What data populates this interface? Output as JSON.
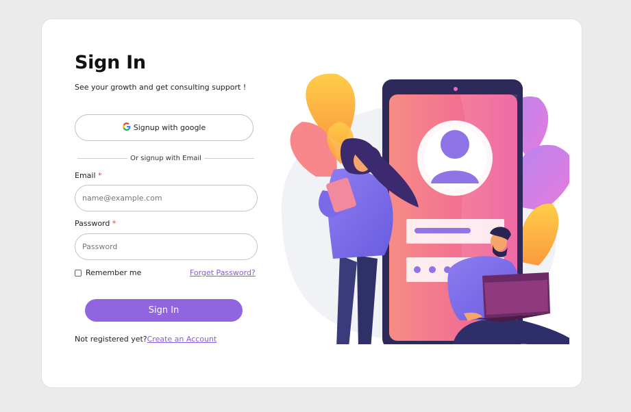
{
  "form": {
    "title": "Sign In",
    "subtitle": "See your growth and get consulting support !",
    "google_label": "Signup with google",
    "divider_text": "Or signup with Email",
    "email_label": "Email",
    "email_placeholder": "name@example.com",
    "password_label": "Password",
    "password_placeholder": "Password",
    "required_mark": "*",
    "remember_label": "Remember me",
    "forgot_label": "Forget Password?",
    "submit_label": "Sign In",
    "footer_text": "Not registered yet?",
    "footer_link": "Create an Account"
  },
  "colors": {
    "accent": "#9165e0",
    "link": "#8a5cd8",
    "background": "#ebebeb",
    "card": "#ffffff"
  },
  "icons": {
    "google": "google-icon",
    "illustration": "signin-illustration"
  }
}
